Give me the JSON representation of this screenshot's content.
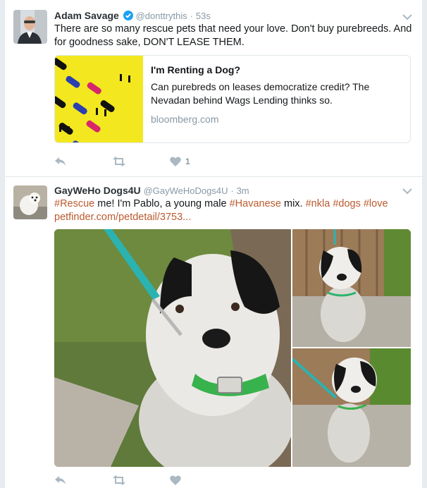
{
  "tweets": [
    {
      "fullname": "Adam Savage",
      "username": "@donttrythis",
      "dot": "·",
      "time": "53s",
      "text": "There are so many rescue pets that need your love. Don't buy purebreeds. And for goodness sake, DON'T LEASE THEM.",
      "card": {
        "title": "I'm Renting a Dog?",
        "description": "Can purebreds on leases democratize credit? The Nevadan behind Wags Lending thinks so.",
        "domain": "bloomberg.com"
      },
      "actions": {
        "like_count": "1"
      },
      "icons": [
        "verified-badge-icon",
        "caret-down-icon",
        "reply-icon",
        "retweet-icon",
        "heart-icon"
      ]
    },
    {
      "fullname": "GayWeHo Dogs4U",
      "username": "@GayWeHoDogs4U",
      "dot": "·",
      "time": "3m",
      "text_parts": {
        "hashtag_rescue": "#Rescue",
        "plain_1": " me! I'm Pablo, a young male ",
        "hashtag_havanese": "#Havanese",
        "plain_2": " mix. ",
        "hashtag_nkla": "#nkla",
        "space_1": " ",
        "hashtag_dogs": "#dogs",
        "space_2": " ",
        "hashtag_love": "#love",
        "link": "petfinder.com/petdetail/3753..."
      },
      "icons": [
        "caret-down-icon",
        "reply-icon",
        "retweet-icon",
        "heart-icon"
      ]
    }
  ],
  "colors": {
    "hashtag": "#bb5a2e",
    "muted": "#8899a6",
    "action_icon": "#aab8c2",
    "verified": "#1da1f2",
    "card_bg": "#f3e81f"
  }
}
